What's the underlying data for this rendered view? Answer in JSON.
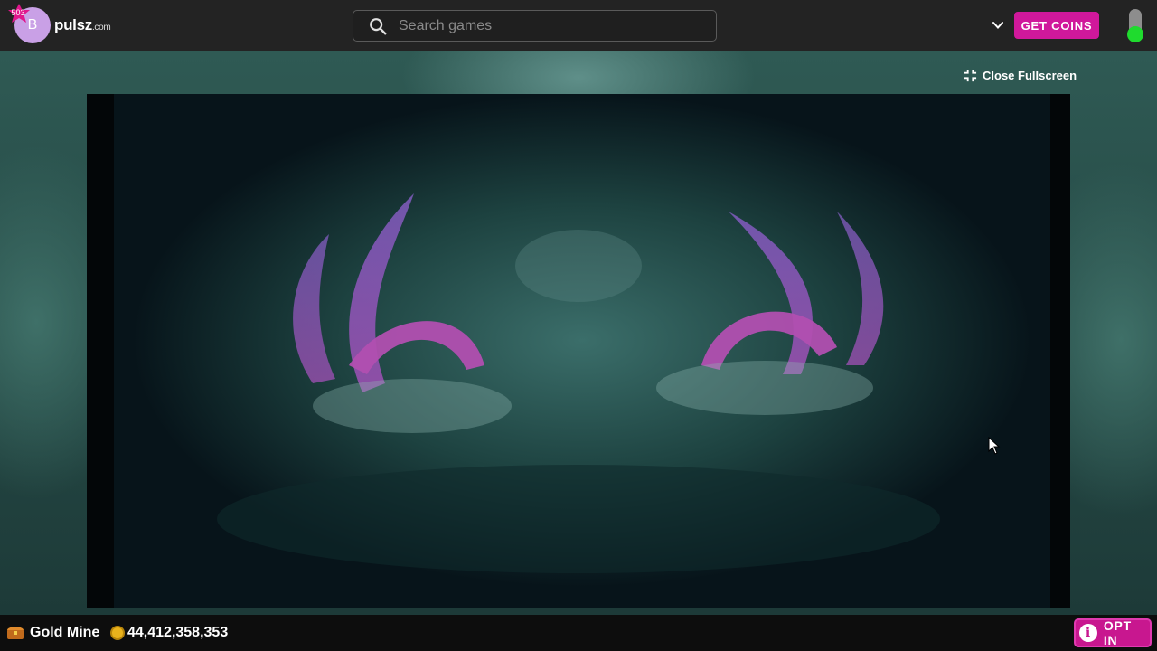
{
  "header": {
    "avatar_initial": "B",
    "level_badge": "503",
    "logo": "pulsz",
    "logo_suffix": ".com",
    "search_placeholder": "Search games",
    "get_coins_label": "GET COINS"
  },
  "game_area": {
    "close_fullscreen_label": "Close Fullscreen"
  },
  "footer": {
    "mode_label": "Gold Mine",
    "coin_balance": "44,412,358,353",
    "opt_in_label": "OPT IN",
    "info_icon_glyph": "i"
  },
  "colors": {
    "accent": "#d0189b",
    "toggle_on": "#1fdb2e",
    "coin": "#e9b21c"
  }
}
